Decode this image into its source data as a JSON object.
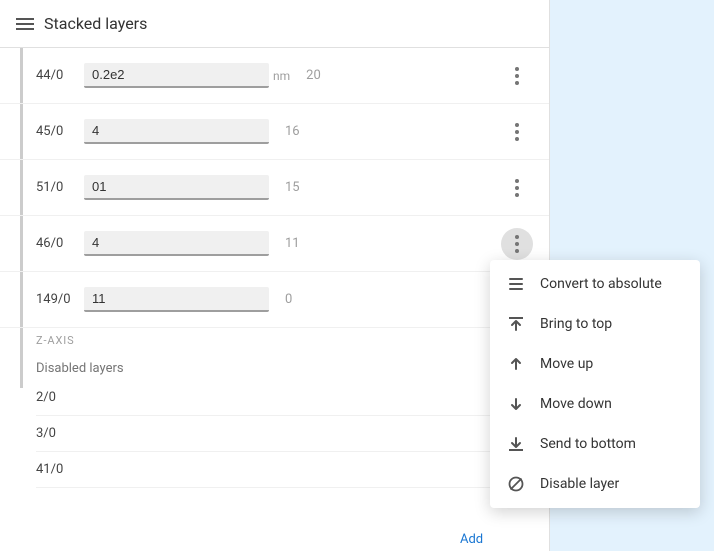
{
  "header": {
    "title": "Stacked layers",
    "icon": "menu-icon"
  },
  "layers": [
    {
      "id": "44/0",
      "value": "0.2e2",
      "unit": "nm",
      "secondary": "20"
    },
    {
      "id": "45/0",
      "value": "4",
      "unit": "",
      "secondary": "16"
    },
    {
      "id": "51/0",
      "value": "01",
      "unit": "",
      "secondary": "15"
    },
    {
      "id": "46/0",
      "value": "4",
      "unit": "",
      "secondary": "11"
    },
    {
      "id": "149/0",
      "value": "11",
      "unit": "",
      "secondary": "0"
    }
  ],
  "zAxisLabel": "Z-AXIS",
  "disabledSection": {
    "label": "Disabled layers",
    "items": [
      "2/0",
      "3/0",
      "41/0"
    ]
  },
  "addButton": "Add",
  "contextMenu": {
    "items": [
      {
        "id": "convert-to-absolute",
        "label": "Convert to absolute",
        "icon": "list-icon"
      },
      {
        "id": "bring-to-top",
        "label": "Bring to top",
        "icon": "bring-top-icon"
      },
      {
        "id": "move-up",
        "label": "Move up",
        "icon": "move-up-icon"
      },
      {
        "id": "move-down",
        "label": "Move down",
        "icon": "move-down-icon"
      },
      {
        "id": "send-to-bottom",
        "label": "Send to bottom",
        "icon": "send-bottom-icon"
      },
      {
        "id": "disable-layer",
        "label": "Disable layer",
        "icon": "disable-icon"
      }
    ]
  }
}
